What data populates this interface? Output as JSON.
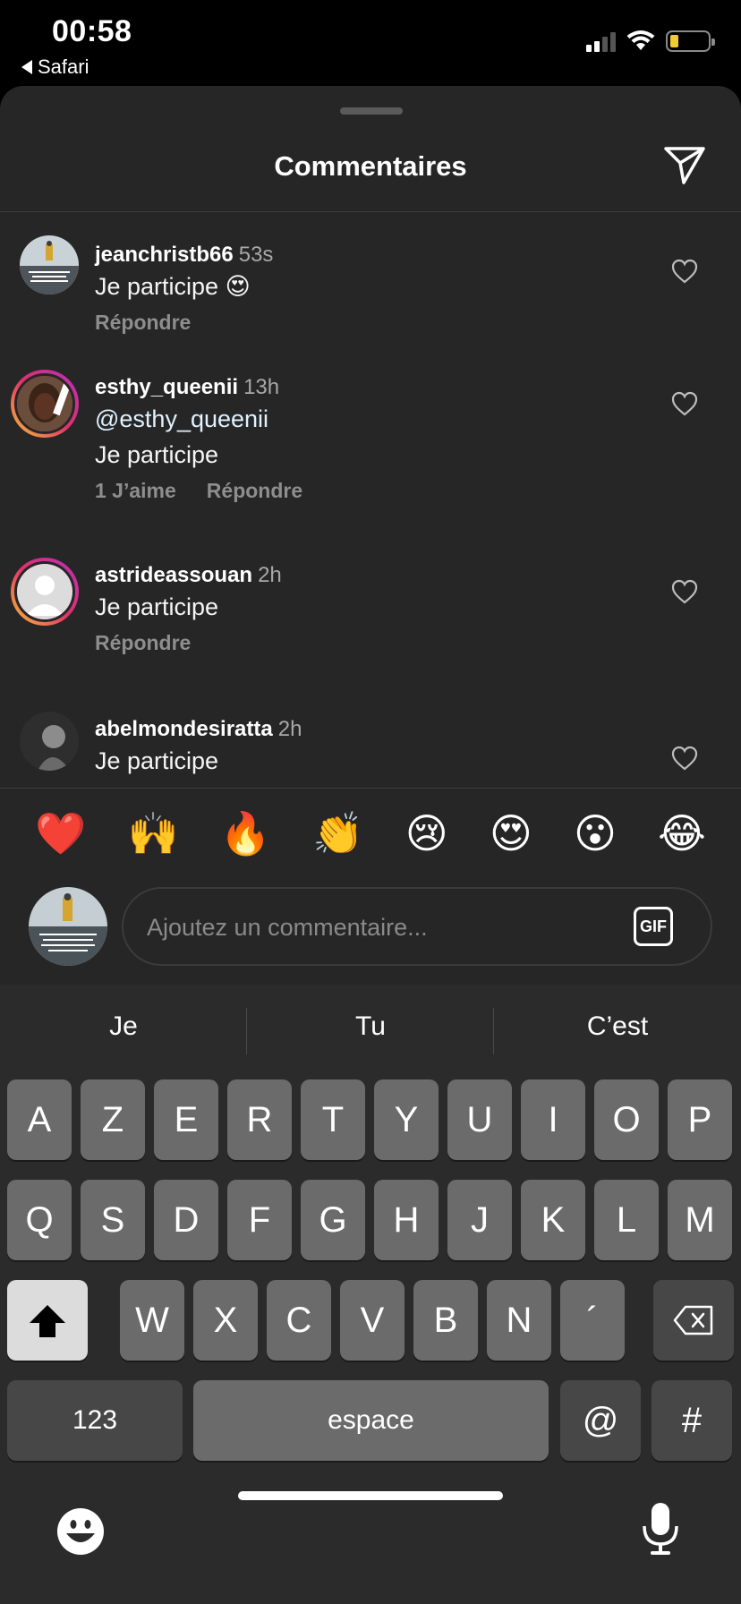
{
  "status_bar": {
    "time": "00:58",
    "back_app": "Safari"
  },
  "sheet": {
    "title": "Commentaires"
  },
  "comments": [
    {
      "username": "jeanchristb66",
      "time": "53s",
      "lines": [
        "Je participe 😍"
      ],
      "likes": "",
      "reply": "Répondre"
    },
    {
      "username": "esthy_queenii",
      "time": "13h",
      "lines": [
        "@esthy_queenii",
        "Je participe"
      ],
      "likes": "1 J’aime",
      "reply": "Répondre"
    },
    {
      "username": "astrideassouan",
      "time": "2h",
      "lines": [
        "Je participe"
      ],
      "likes": "",
      "reply": "Répondre"
    },
    {
      "username": "abelmondesiratta",
      "time": "2h",
      "lines": [
        "Je participe"
      ],
      "likes": "",
      "reply": ""
    }
  ],
  "emoji_bar": [
    "❤️",
    "🙌",
    "🔥",
    "👏",
    "😢",
    "😍",
    "😮",
    "😂"
  ],
  "input": {
    "placeholder": "Ajoutez un commentaire...",
    "gif_label": "GIF"
  },
  "keyboard": {
    "suggestions": [
      "Je",
      "Tu",
      "C’est"
    ],
    "row1": [
      "A",
      "Z",
      "E",
      "R",
      "T",
      "Y",
      "U",
      "I",
      "O",
      "P"
    ],
    "row2": [
      "Q",
      "S",
      "D",
      "F",
      "G",
      "H",
      "J",
      "K",
      "L",
      "M"
    ],
    "row3": [
      "W",
      "X",
      "C",
      "V",
      "B",
      "N",
      "´"
    ],
    "numbers_label": "123",
    "space_label": "espace",
    "at_label": "@",
    "hash_label": "#"
  },
  "colors": {
    "sheet_bg": "#262626",
    "keyboard_bg": "#2b2b2b",
    "key_bg": "#6b6b6b",
    "muted_text": "#8e8e8e",
    "battery_level": "#f2cb2f"
  }
}
